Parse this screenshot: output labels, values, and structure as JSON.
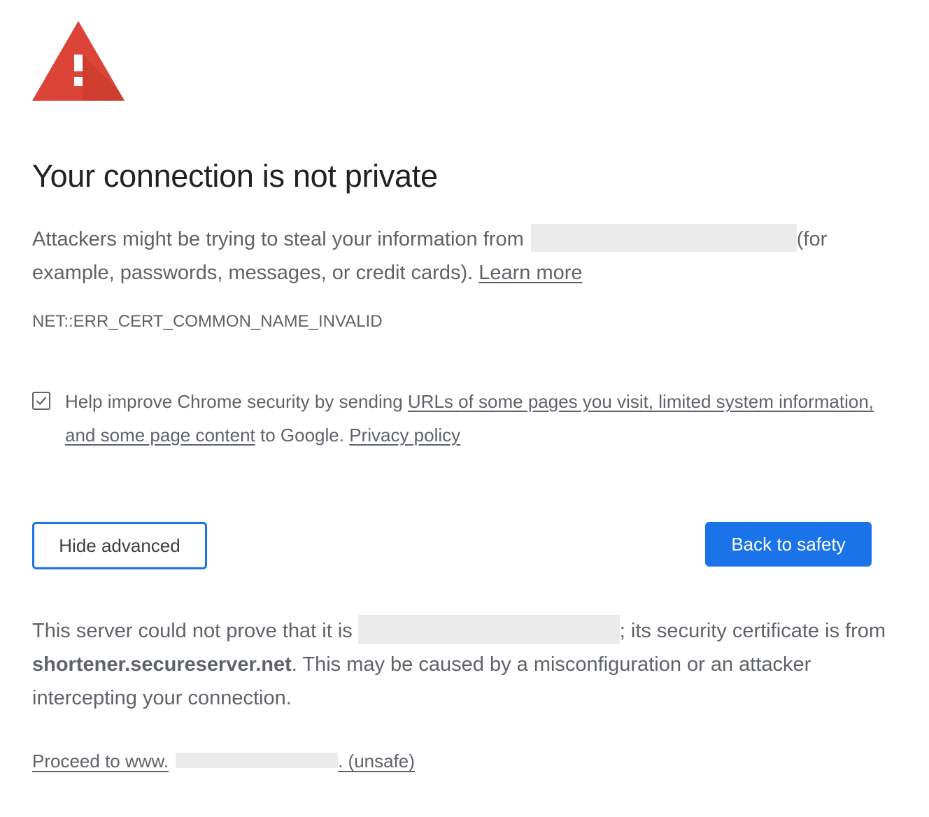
{
  "icons": {
    "warning": "warning-triangle-icon",
    "check": "checkmark-icon"
  },
  "colors": {
    "warning_red": "#db4437",
    "primary_blue": "#1a73e8",
    "title_text": "#202124",
    "body_text": "#5f6368",
    "redaction": "#ebebeb"
  },
  "page": {
    "title": "Your connection is not private",
    "intro_before": "Attackers might be trying to steal your information from",
    "intro_after": "(for example, passwords, messages, or credit cards).",
    "learn_more": "Learn more",
    "error_code": "NET::ERR_CERT_COMMON_NAME_INVALID"
  },
  "optin": {
    "checked": true,
    "text_before": "Help improve Chrome security by sending",
    "link_text": "URLs of some pages you visit, limited system information, and some page content",
    "text_middle": "to Google.",
    "privacy_link": "Privacy policy"
  },
  "buttons": {
    "hide_advanced": "Hide advanced",
    "back_to_safety": "Back to safety"
  },
  "details": {
    "before": "This server could not prove that it is",
    "after_redaction": "; its security certificate is from",
    "domain": "shortener.secureserver.net",
    "rest": ". This may be caused by a misconfiguration or an attacker intercepting your connection."
  },
  "proceed": {
    "prefix": "Proceed to www.",
    "suffix": ". (unsafe)"
  }
}
